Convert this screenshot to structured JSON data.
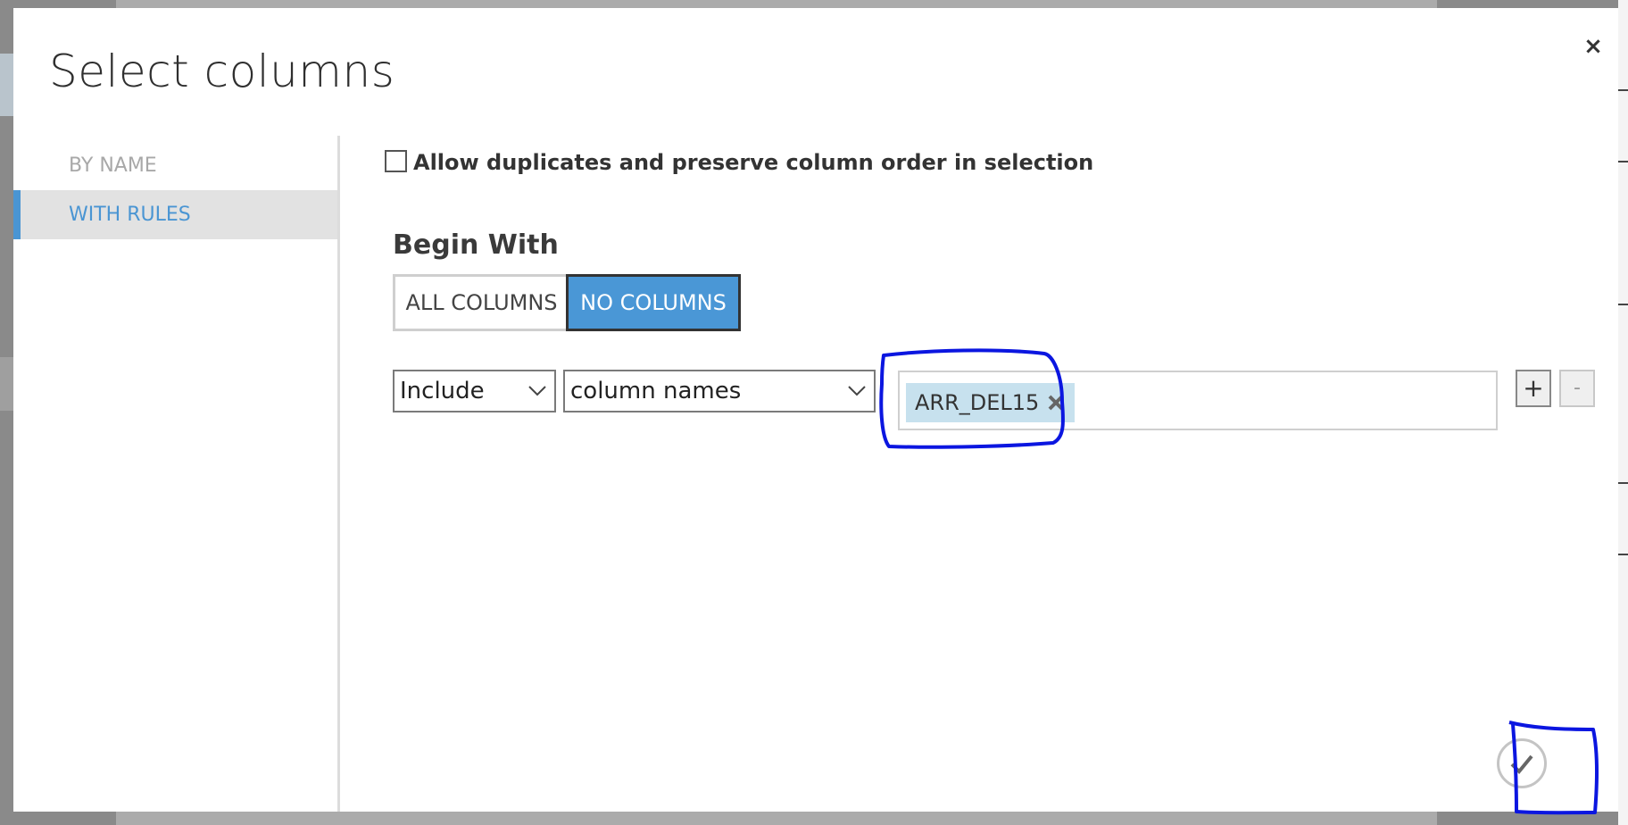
{
  "dialog": {
    "title": "Select columns",
    "close_label": "×"
  },
  "sidebar": {
    "items": [
      {
        "label": "BY NAME"
      },
      {
        "label": "WITH RULES"
      }
    ]
  },
  "options": {
    "allow_duplicates_label": "Allow duplicates and preserve column order in selection",
    "allow_duplicates_checked": false
  },
  "begin_with": {
    "label": "Begin With",
    "all_columns": "ALL COLUMNS",
    "no_columns": "NO COLUMNS",
    "selected": "NO COLUMNS"
  },
  "rule": {
    "mode": "Include",
    "type": "column names",
    "tags": [
      "ARR_DEL15"
    ],
    "add_label": "+",
    "remove_label": "-"
  },
  "colors": {
    "accent": "#4a97d6",
    "tag_bg": "#c7e1ee",
    "annotation": "#0b16e0"
  }
}
